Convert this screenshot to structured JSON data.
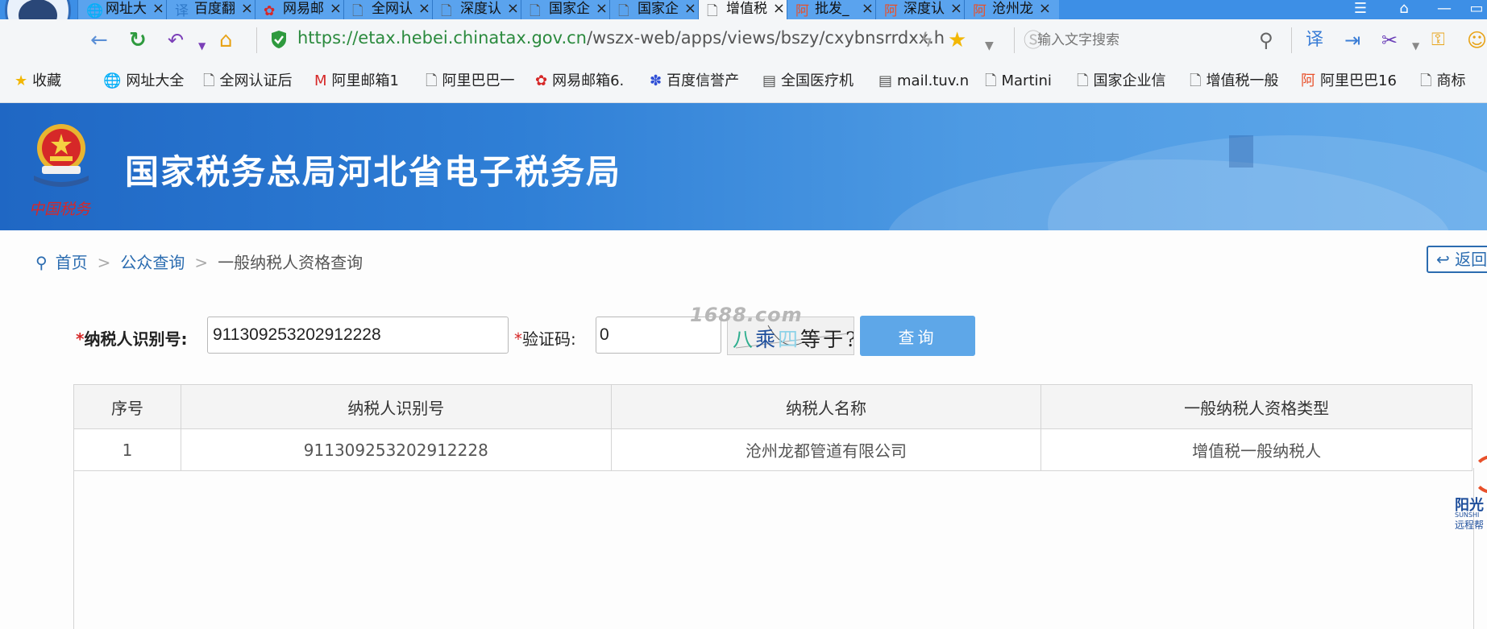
{
  "browser": {
    "tabs": [
      {
        "title": "网址大",
        "icon": "globe-icon",
        "active": false
      },
      {
        "title": "百度翻",
        "icon": "translate-icon",
        "active": false
      },
      {
        "title": "网易邮",
        "icon": "netease-icon",
        "active": false
      },
      {
        "title": "全网认",
        "icon": "page-icon",
        "active": false
      },
      {
        "title": "深度认",
        "icon": "page-icon",
        "active": false
      },
      {
        "title": "国家企",
        "icon": "page-icon",
        "active": false
      },
      {
        "title": "国家企",
        "icon": "page-icon",
        "active": false
      },
      {
        "title": "增值税",
        "icon": "page-icon",
        "active": true
      },
      {
        "title": "批发_",
        "icon": "alibaba-icon",
        "active": false
      },
      {
        "title": "深度认",
        "icon": "alibaba-icon",
        "active": false
      },
      {
        "title": "沧州龙",
        "icon": "alibaba-icon",
        "active": false
      }
    ],
    "url": {
      "host": "https://etax.hebei.chinatax.gov.cn",
      "path": "/wszx-web/apps/views/bszy/cxybnsrrdxx.h"
    },
    "search_placeholder": "输入文字搜索",
    "bookmarks": [
      {
        "label": "收藏",
        "icon": "star-icon"
      },
      {
        "label": "网址大全",
        "icon": "globe-icon"
      },
      {
        "label": "全网认证后",
        "icon": "page-icon"
      },
      {
        "label": "阿里邮箱1",
        "icon": "mail-icon"
      },
      {
        "label": "阿里巴巴一",
        "icon": "page-icon"
      },
      {
        "label": "网易邮箱6.",
        "icon": "netease-icon"
      },
      {
        "label": "百度信誉产",
        "icon": "baidu-icon"
      },
      {
        "label": "全国医疗机",
        "icon": "doc-icon"
      },
      {
        "label": "mail.tuv.n",
        "icon": "doc-icon"
      },
      {
        "label": "Martini",
        "icon": "page-icon"
      },
      {
        "label": "国家企业信",
        "icon": "page-icon"
      },
      {
        "label": "增值税一般",
        "icon": "page-icon"
      },
      {
        "label": "阿里巴巴16",
        "icon": "alibaba-icon"
      },
      {
        "label": "商标",
        "icon": "page-icon"
      }
    ]
  },
  "banner": {
    "title": "国家税务总局河北省电子税务局",
    "emblem_caption": "中国税务"
  },
  "breadcrumb": {
    "home": "首页",
    "public_query": "公众查询",
    "current": "一般纳税人资格查询",
    "separator": ">"
  },
  "return_button": "返回",
  "form": {
    "required_mark": "*",
    "tin_label": "纳税人识别号:",
    "tin_value": "911309253202912228",
    "captcha_label": "验证码:",
    "captcha_value": "0",
    "captcha_image_text": "八乘四等于?",
    "watermark": "1688.com",
    "query_button": "查询"
  },
  "table": {
    "headers": [
      "序号",
      "纳税人识别号",
      "纳税人名称",
      "一般纳税人资格类型"
    ],
    "rows": [
      {
        "index": "1",
        "tin": "911309253202912228",
        "name": "沧州龙都管道有限公司",
        "type": "增值税一般纳税人"
      }
    ]
  },
  "floating_widget": {
    "line1": "阳光",
    "line2": "SUNSHI",
    "line3": "远程帮"
  },
  "colors": {
    "tab_strip": "#3d8fe6",
    "banner": "#2f7fd6",
    "link": "#2b6cb0",
    "query_button": "#5ea7e8",
    "required": "#d62828"
  }
}
